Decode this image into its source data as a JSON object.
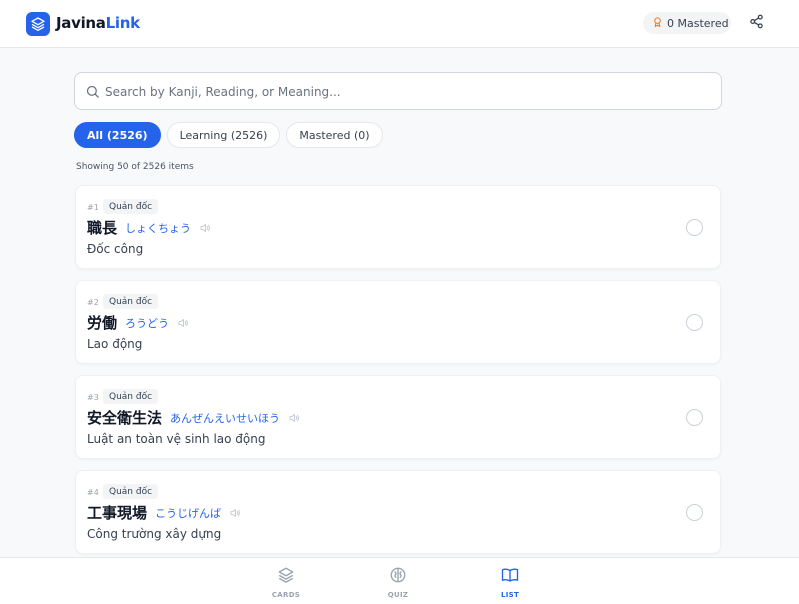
{
  "header": {
    "brand_prefix": "Javina",
    "brand_suffix": "Link",
    "mastered_label": "0 Mastered"
  },
  "search": {
    "placeholder": "Search by Kanji, Reading, or Meaning...",
    "value": ""
  },
  "filters": [
    {
      "label": "All (2526)",
      "active": true
    },
    {
      "label": "Learning (2526)",
      "active": false
    },
    {
      "label": "Mastered (0)",
      "active": false
    }
  ],
  "showing": "Showing 50 of 2526 items",
  "items": [
    {
      "num": "#1",
      "tag": "Quản đốc",
      "kanji": "職長",
      "reading": "しょくちょう",
      "meaning": "Đốc công"
    },
    {
      "num": "#2",
      "tag": "Quản đốc",
      "kanji": "労働",
      "reading": "ろうどう",
      "meaning": "Lao động"
    },
    {
      "num": "#3",
      "tag": "Quản đốc",
      "kanji": "安全衛生法",
      "reading": "あんぜんえいせいほう",
      "meaning": "Luật an toàn vệ sinh lao động"
    },
    {
      "num": "#4",
      "tag": "Quản đốc",
      "kanji": "工事現場",
      "reading": "こうじげんば",
      "meaning": "Công trường xây dựng"
    }
  ],
  "nav": {
    "cards": "CARDS",
    "quiz": "QUIZ",
    "list": "LIST"
  },
  "colors": {
    "accent": "#2563eb",
    "award": "#f97316"
  },
  "icons": {
    "logo": "layers-icon",
    "mastered": "award-icon",
    "share": "share-icon",
    "search": "search-icon",
    "speaker": "speaker-icon",
    "cards": "layers-icon",
    "quiz": "brain-icon",
    "list": "book-open-icon"
  }
}
